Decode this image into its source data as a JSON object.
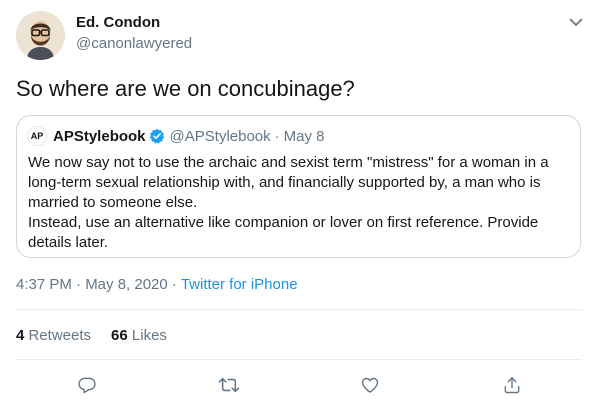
{
  "author": {
    "name": "Ed. Condon",
    "handle": "@canonlawyered"
  },
  "tweet": {
    "text": "So where are we on concubinage?"
  },
  "quote": {
    "logo_text": "AP",
    "name": "APStylebook",
    "handle": "@APStylebook",
    "separator": "·",
    "date": "May 8",
    "paragraph1": "We now say not to use the archaic and sexist term \"mistress\" for a woman in a long-term sexual relationship with, and financially supported by, a man who is married to someone else.",
    "paragraph2": "Instead, use an alternative like companion or lover on first reference. Provide details later."
  },
  "meta": {
    "time": "4:37 PM · May 8, 2020 · ",
    "source": "Twitter for iPhone"
  },
  "stats": {
    "retweets_count": "4",
    "retweets_label": " Retweets",
    "likes_count": "66",
    "likes_label": " Likes"
  },
  "colors": {
    "link": "#1b95e0",
    "verified": "#1da1f2",
    "secondary_text": "#657786",
    "border": "#ccd6dd"
  },
  "icons": [
    "chevron-down-icon",
    "verified-icon",
    "reply-icon",
    "retweet-icon",
    "like-icon",
    "share-icon"
  ]
}
